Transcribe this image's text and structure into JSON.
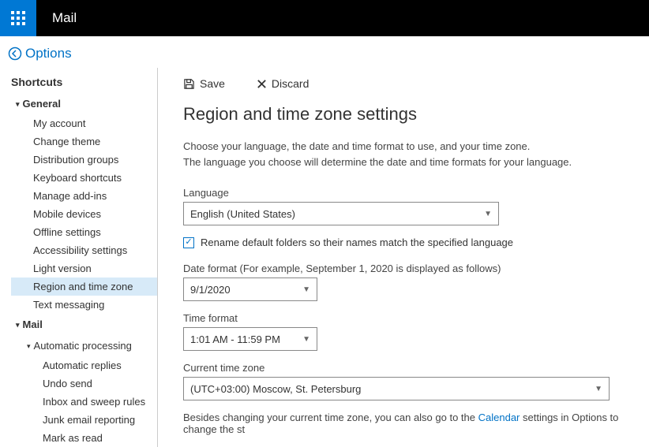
{
  "app_title": "Mail",
  "back_label": "Options",
  "sidebar": {
    "shortcuts": "Shortcuts",
    "general": "General",
    "general_items": [
      "My account",
      "Change theme",
      "Distribution groups",
      "Keyboard shortcuts",
      "Manage add-ins",
      "Mobile devices",
      "Offline settings",
      "Accessibility settings",
      "Light version",
      "Region and time zone",
      "Text messaging"
    ],
    "general_selected_index": 9,
    "mail": "Mail",
    "auto_proc": "Automatic processing",
    "auto_items": [
      "Automatic replies",
      "Undo send",
      "Inbox and sweep rules",
      "Junk email reporting",
      "Mark as read"
    ]
  },
  "toolbar": {
    "save": "Save",
    "discard": "Discard"
  },
  "page": {
    "title": "Region and time zone settings",
    "desc1": "Choose your language, the date and time format to use, and your time zone.",
    "desc2": "The language you choose will determine the date and time formats for your language.",
    "language_label": "Language",
    "language_value": "English (United States)",
    "rename_checked": true,
    "rename_label": "Rename default folders so their names match the specified language",
    "date_label": "Date format (For example, September 1, 2020 is displayed as follows)",
    "date_value": "9/1/2020",
    "time_label": "Time format",
    "time_value": "1:01 AM - 11:59 PM",
    "tz_label": "Current time zone",
    "tz_value": "(UTC+03:00) Moscow, St. Petersburg",
    "footer_pre": "Besides changing your current time zone, you can also go to the ",
    "footer_link": "Calendar",
    "footer_post": " settings in Options to change the st"
  }
}
